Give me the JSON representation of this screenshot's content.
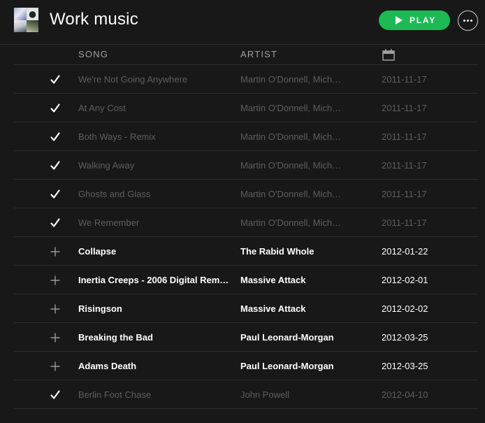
{
  "playlist": {
    "title": "Work music",
    "play_label": "PLAY"
  },
  "columns": {
    "song": "SONG",
    "artist": "ARTIST"
  },
  "colors": {
    "accent": "#1db954",
    "background": "#181818"
  },
  "tracks": [
    {
      "song": "We're Not Going Anywhere",
      "artist": "Martin O'Donnell, Mich…",
      "date": "2011-11-17",
      "state": "added",
      "icon": "check-icon"
    },
    {
      "song": "At Any Cost",
      "artist": "Martin O'Donnell, Mich…",
      "date": "2011-11-17",
      "state": "added",
      "icon": "check-icon"
    },
    {
      "song": "Both Ways - Remix",
      "artist": "Martin O'Donnell, Mich…",
      "date": "2011-11-17",
      "state": "added",
      "icon": "check-icon"
    },
    {
      "song": "Walking Away",
      "artist": "Martin O'Donnell, Mich…",
      "date": "2011-11-17",
      "state": "added",
      "icon": "check-icon"
    },
    {
      "song": "Ghosts and Glass",
      "artist": "Martin O'Donnell, Mich…",
      "date": "2011-11-17",
      "state": "added",
      "icon": "check-icon"
    },
    {
      "song": "We Remember",
      "artist": "Martin O'Donnell, Mich…",
      "date": "2011-11-17",
      "state": "added",
      "icon": "check-icon"
    },
    {
      "song": "Collapse",
      "artist": "The Rabid Whole",
      "date": "2012-01-22",
      "state": "not-added",
      "icon": "plus-icon"
    },
    {
      "song": "Inertia Creeps - 2006 Digital Rem…",
      "artist": "Massive Attack",
      "date": "2012-02-01",
      "state": "not-added",
      "icon": "plus-icon"
    },
    {
      "song": "Risingson",
      "artist": "Massive Attack",
      "date": "2012-02-02",
      "state": "not-added",
      "icon": "plus-icon"
    },
    {
      "song": "Breaking the Bad",
      "artist": "Paul Leonard-Morgan",
      "date": "2012-03-25",
      "state": "not-added",
      "icon": "plus-icon"
    },
    {
      "song": "Adams Death",
      "artist": "Paul Leonard-Morgan",
      "date": "2012-03-25",
      "state": "not-added",
      "icon": "plus-icon"
    },
    {
      "song": "Berlin Foot Chase",
      "artist": "John Powell",
      "date": "2012-04-10",
      "state": "added",
      "icon": "check-icon"
    }
  ]
}
